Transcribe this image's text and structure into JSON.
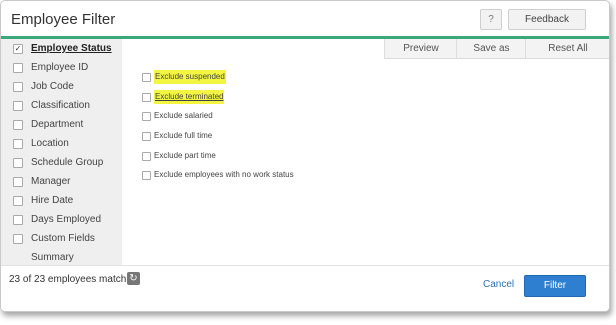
{
  "dialog": {
    "title": "Employee Filter",
    "help_label": "?",
    "feedback_label": "Feedback"
  },
  "sidebar": {
    "items": [
      {
        "label": "Employee Status",
        "checked": true
      },
      {
        "label": "Employee ID",
        "checked": false
      },
      {
        "label": "Job Code",
        "checked": false
      },
      {
        "label": "Classification",
        "checked": false
      },
      {
        "label": "Department",
        "checked": false
      },
      {
        "label": "Location",
        "checked": false
      },
      {
        "label": "Schedule Group",
        "checked": false
      },
      {
        "label": "Manager",
        "checked": false
      },
      {
        "label": "Hire Date",
        "checked": false
      },
      {
        "label": "Days Employed",
        "checked": false
      },
      {
        "label": "Custom Fields",
        "checked": false
      }
    ],
    "summary_label": "Summary"
  },
  "toolbar": {
    "preview_label": "Preview",
    "save_as_label": "Save as",
    "reset_all_label": "Reset All"
  },
  "options": [
    {
      "label": "Exclude suspended",
      "highlighted": true
    },
    {
      "label": "Exclude terminated",
      "highlighted": true
    },
    {
      "label": "Exclude salaried",
      "highlighted": false
    },
    {
      "label": "Exclude full time",
      "highlighted": false
    },
    {
      "label": "Exclude part time",
      "highlighted": false
    },
    {
      "label": "Exclude employees with no work status",
      "highlighted": false
    }
  ],
  "footer": {
    "match_text": "23 of 23 employees match",
    "cancel_label": "Cancel",
    "filter_label": "Filter"
  },
  "colors": {
    "accent_green": "#3aa87b",
    "primary_blue": "#2f7fd1",
    "highlight_yellow": "#f3f542"
  }
}
